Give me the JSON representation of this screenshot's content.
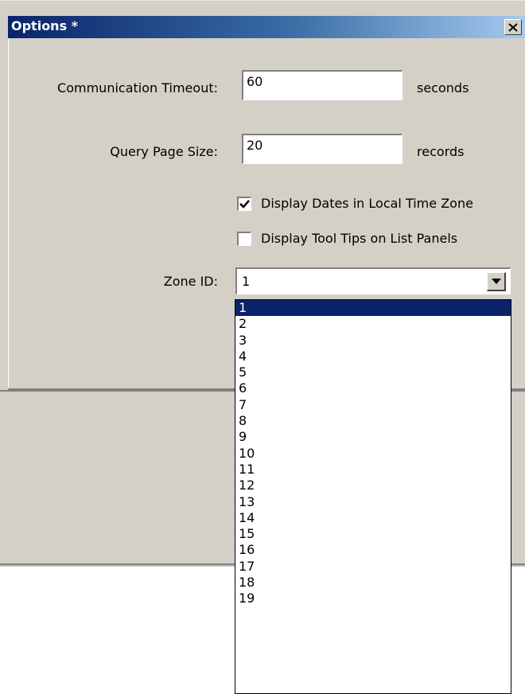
{
  "window": {
    "title": "Options *"
  },
  "form": {
    "timeout_label": "Communication Timeout:",
    "timeout_value": "60",
    "timeout_unit": "seconds",
    "page_size_label": "Query Page Size:",
    "page_size_value": "20",
    "page_size_unit": "records",
    "local_time_label": "Display Dates in Local Time Zone",
    "local_time_checked": true,
    "tool_tips_label": "Display Tool Tips on List Panels",
    "tool_tips_checked": false,
    "zone_label": "Zone ID:",
    "zone_value": "1"
  },
  "zone_options": [
    "1",
    "2",
    "3",
    "4",
    "5",
    "6",
    "7",
    "8",
    "9",
    "10",
    "11",
    "12",
    "13",
    "14",
    "15",
    "16",
    "17",
    "18",
    "19"
  ],
  "zone_selected_index": 0,
  "icons": {
    "close": "close-icon",
    "dropdown": "chevron-down-icon",
    "check": "check-icon"
  },
  "colors": {
    "title_bar_start": "#0a246a",
    "title_bar_end": "#a6caf0",
    "dialog_background": "#d4d0c8",
    "selection": "#0a246a"
  }
}
